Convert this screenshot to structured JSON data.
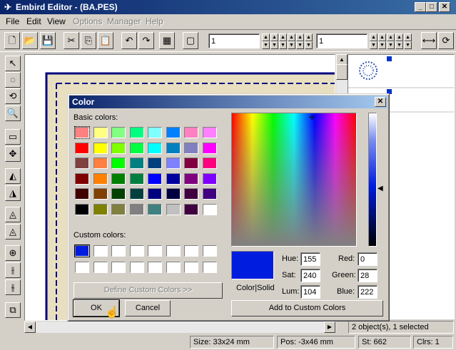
{
  "window": {
    "title": "Embird Editor - (BA.PES)",
    "menu": [
      {
        "label": "File",
        "enabled": true
      },
      {
        "label": "Edit",
        "enabled": true
      },
      {
        "label": "View",
        "enabled": true
      },
      {
        "label": "Options",
        "enabled": false
      },
      {
        "label": "Manager",
        "enabled": false
      },
      {
        "label": "Help",
        "enabled": false
      }
    ]
  },
  "toolbar": {
    "field1_value": "1",
    "field2_value": "1"
  },
  "status": {
    "objects": "2 object(s), 1 selected",
    "size": "Size: 33x24 mm",
    "pos": "Pos: -3x46 mm",
    "stitches": "St: 662",
    "colors": "Clrs: 1"
  },
  "dialog": {
    "title": "Color",
    "basic_colors_label": "Basic colors:",
    "custom_colors_label": "Custom colors:",
    "define_custom_label": "Define Custom Colors >>",
    "ok_label": "OK",
    "cancel_label": "Cancel",
    "add_custom_label": "Add to Custom Colors",
    "color_solid_label": "Color|Solid",
    "hue_label": "Hue:",
    "sat_label": "Sat:",
    "lum_label": "Lum:",
    "red_label": "Red:",
    "green_label": "Green:",
    "blue_label": "Blue:",
    "hue": "155",
    "sat": "240",
    "lum": "104",
    "red": "0",
    "green": "28",
    "blue": "222",
    "current_color": "#001cde",
    "basic_colors": [
      "#ff8080",
      "#ffff80",
      "#80ff80",
      "#00ff80",
      "#80ffff",
      "#0080ff",
      "#ff80c0",
      "#ff80ff",
      "#ff0000",
      "#ffff00",
      "#80ff00",
      "#00ff40",
      "#00ffff",
      "#0080c0",
      "#8080c0",
      "#ff00ff",
      "#804040",
      "#ff8040",
      "#00ff00",
      "#008080",
      "#004080",
      "#8080ff",
      "#800040",
      "#ff0080",
      "#800000",
      "#ff8000",
      "#008000",
      "#008040",
      "#0000ff",
      "#0000a0",
      "#800080",
      "#8000ff",
      "#400000",
      "#804000",
      "#004000",
      "#004040",
      "#000080",
      "#000040",
      "#400040",
      "#400080",
      "#000000",
      "#808000",
      "#808040",
      "#808080",
      "#408080",
      "#c0c0c0",
      "#400040",
      "#ffffff"
    ],
    "custom_colors": [
      "#001cde",
      "#ffffff",
      "#ffffff",
      "#ffffff",
      "#ffffff",
      "#ffffff",
      "#ffffff",
      "#ffffff",
      "#ffffff",
      "#ffffff",
      "#ffffff",
      "#ffffff",
      "#ffffff",
      "#ffffff",
      "#ffffff",
      "#ffffff"
    ]
  }
}
